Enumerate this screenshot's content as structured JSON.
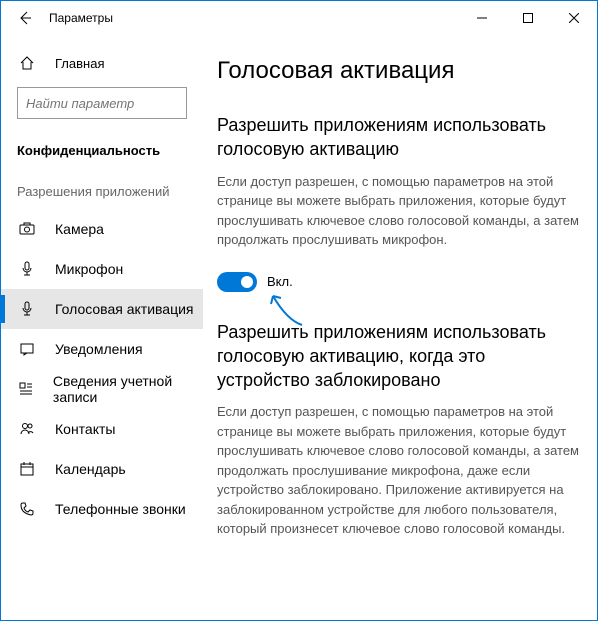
{
  "window": {
    "title": "Параметры"
  },
  "sidebar": {
    "home_label": "Главная",
    "search_placeholder": "Найти параметр",
    "section_header": "Конфиденциальность",
    "group_label": "Разрешения приложений",
    "items": [
      {
        "label": "Камера"
      },
      {
        "label": "Микрофон"
      },
      {
        "label": "Голосовая активация"
      },
      {
        "label": "Уведомления"
      },
      {
        "label": "Сведения учетной записи"
      },
      {
        "label": "Контакты"
      },
      {
        "label": "Календарь"
      },
      {
        "label": "Телефонные звонки"
      }
    ]
  },
  "main": {
    "page_title": "Голосовая активация",
    "section1": {
      "title": "Разрешить приложениям использовать голосовую активацию",
      "desc": "Если доступ разрешен, с помощью параметров на этой странице вы можете выбрать приложения, которые будут прослушивать ключевое слово голосовой команды, а затем продолжать прослушивать микрофон.",
      "toggle_label": "Вкл."
    },
    "section2": {
      "title": "Разрешить приложениям использовать голосовую активацию, когда это устройство заблокировано",
      "desc": "Если доступ разрешен, с помощью параметров на этой странице вы можете выбрать приложения, которые будут прослушивать ключевое слово голосовой команды, а затем продолжать прослушивание микрофона, даже если устройство заблокировано. Приложение активируется на заблокированном устройстве для любого пользователя, который произнесет ключевое слово голосовой команды."
    }
  }
}
